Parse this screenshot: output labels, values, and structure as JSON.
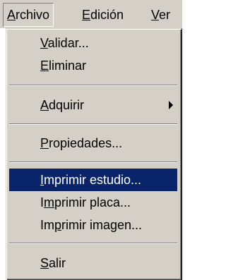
{
  "menubar": {
    "items": [
      {
        "pre": "",
        "key": "A",
        "post": "rchivo"
      },
      {
        "pre": "",
        "key": "E",
        "post": "dición"
      },
      {
        "pre": "",
        "key": "V",
        "post": "er"
      }
    ]
  },
  "menu": {
    "items": [
      {
        "pre": "",
        "key": "V",
        "post": "alidar..."
      },
      {
        "pre": "",
        "key": "E",
        "post": "liminar"
      },
      {
        "pre": "",
        "key": "A",
        "post": "dquirir",
        "submenu_icon": "submenu-arrow-icon"
      },
      {
        "pre": "",
        "key": "P",
        "post": "ropiedades..."
      },
      {
        "pre": "",
        "key": "I",
        "post": "mprimir estudio..."
      },
      {
        "pre": "I",
        "key": "m",
        "post": "primir placa..."
      },
      {
        "pre": "Im",
        "key": "p",
        "post": "rimir imagen..."
      },
      {
        "pre": "",
        "key": "S",
        "post": "alir"
      }
    ]
  },
  "colors": {
    "menu_bg": "#d4d0c8",
    "highlight_bg": "#0a246a",
    "highlight_fg": "#ffffff"
  }
}
